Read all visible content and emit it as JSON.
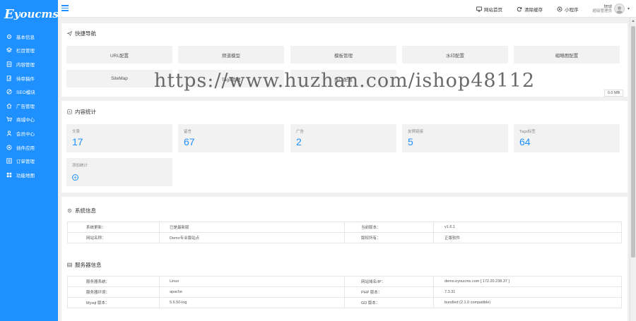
{
  "brand": {
    "logo_text": "youcms",
    "logo_initial": "E"
  },
  "sidebar": {
    "items": [
      {
        "label": "基本信息",
        "icon": "gear-icon"
      },
      {
        "label": "栏目管理",
        "icon": "layers-icon"
      },
      {
        "label": "内容管理",
        "icon": "document-icon"
      },
      {
        "label": "待审稿件",
        "icon": "edit-doc-icon"
      },
      {
        "label": "SEO模块",
        "icon": "target-icon"
      },
      {
        "label": "广告管理",
        "icon": "home-icon"
      },
      {
        "label": "商城中心",
        "icon": "cart-icon"
      },
      {
        "label": "会员中心",
        "icon": "user-icon"
      },
      {
        "label": "插件应用",
        "icon": "plugin-icon"
      },
      {
        "label": "订单管理",
        "icon": "list-icon"
      },
      {
        "label": "功能地图",
        "icon": "grid-icon"
      }
    ]
  },
  "topbar": {
    "home_label": "网站首页",
    "clear_cache_label": "清除缓存",
    "mini_program_label": "小程序",
    "user_name": "test",
    "user_role": "超级管理员"
  },
  "quick_nav": {
    "title": "快捷导航",
    "buttons": [
      "URL配置",
      "频道模型",
      "模板管理",
      "水印配置",
      "缩略图配置",
      "SiteMap",
      "Tags管理",
      "接口配置"
    ],
    "cache_size": "0.0 MB"
  },
  "content_stats": {
    "title": "内容统计",
    "items": [
      {
        "label": "文章",
        "value": "17"
      },
      {
        "label": "留言",
        "value": "67"
      },
      {
        "label": "广告",
        "value": "2"
      },
      {
        "label": "友情链接",
        "value": "5"
      },
      {
        "label": "Tags标签",
        "value": "64"
      }
    ],
    "add_label": "添加统计"
  },
  "system_info": {
    "title": "系统信息",
    "rows": [
      [
        "系统更新：",
        "已是最新版",
        "当前版本：",
        "v1.6.1"
      ],
      [
        "网站名称：",
        "Demo专业版站点",
        "版权所有：",
        "正版软件"
      ]
    ]
  },
  "server_info": {
    "title": "服务器信息",
    "rows": [
      [
        "服务器系统：",
        "Linux",
        "网站域名/IP：",
        "demo.eyoucms.com [ 172.20.238.37 ]"
      ],
      [
        "服务器环境：",
        "apache",
        "PHP 版本：",
        "7.3.31"
      ],
      [
        "Mysql 版本：",
        "5.6.50-log",
        "GD 版本：",
        "bundled (2.1.0 compatible)"
      ]
    ]
  },
  "watermark": "https://www.huzhan.com/ishop48112",
  "colors": {
    "accent": "#1e90ff",
    "panel_bg": "#ffffff",
    "page_bg": "#f0f0f0"
  }
}
